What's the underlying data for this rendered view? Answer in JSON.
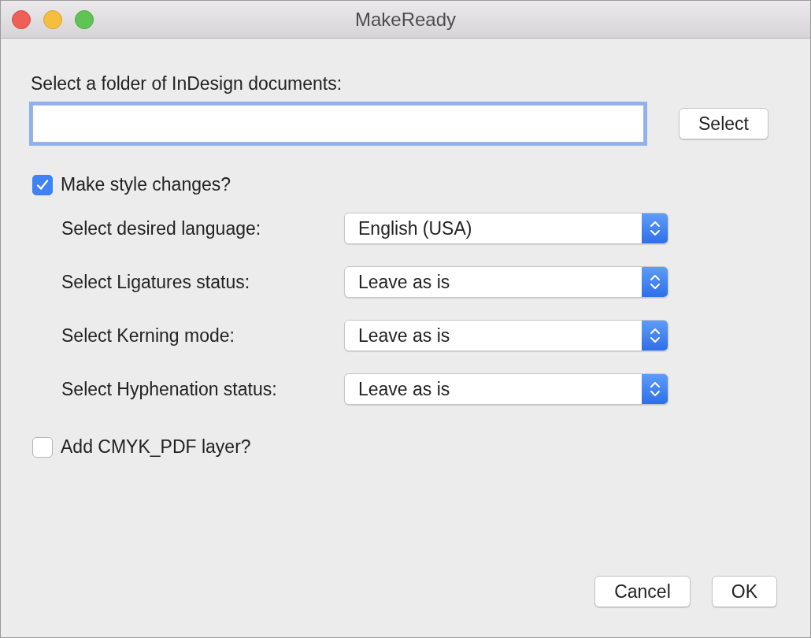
{
  "window": {
    "title": "MakeReady"
  },
  "folder": {
    "label": "Select a folder of InDesign documents:",
    "focused": true,
    "button": "Select"
  },
  "style_changes": {
    "label": "Make style changes?",
    "checked": true
  },
  "popups": [
    {
      "label": "Select desired language:",
      "value": "English (USA)"
    },
    {
      "label": "Select Ligatures status:",
      "value": "Leave as is"
    },
    {
      "label": "Select Kerning mode:",
      "value": "Leave as is"
    },
    {
      "label": "Select Hyphenation status:",
      "value": "Leave as is"
    }
  ],
  "cmyk_layer": {
    "label": "Add CMYK_PDF layer?",
    "checked": false
  },
  "buttons": [
    {
      "label": "Cancel"
    },
    {
      "label": "OK"
    }
  ]
}
